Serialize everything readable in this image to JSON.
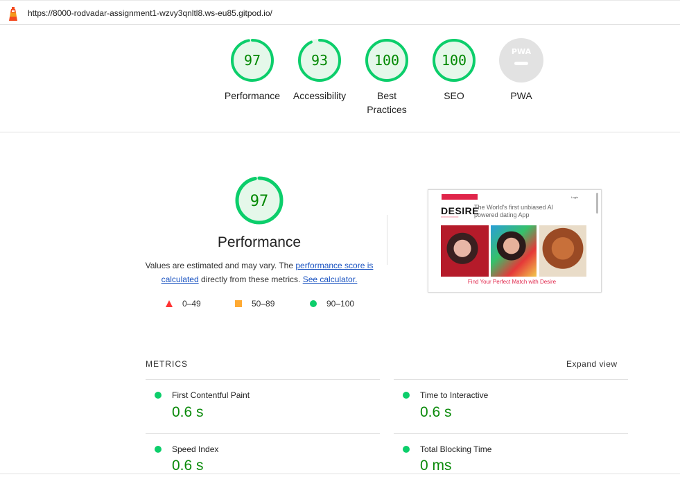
{
  "topbar": {
    "url": "https://8000-rodvadar-assignment1-wzvy3qnltl8.ws-eu85.gitpod.io/"
  },
  "gauges": [
    {
      "label": "Performance",
      "score": "97",
      "value": 97
    },
    {
      "label": "Accessibility",
      "score": "93",
      "value": 93
    },
    {
      "label": "Best\nPractices",
      "score": "100",
      "value": 100
    },
    {
      "label": "SEO",
      "score": "100",
      "value": 100
    },
    {
      "label": "PWA",
      "score": "",
      "value": null
    }
  ],
  "pwa_badge": "PWA",
  "performance": {
    "score": "97",
    "value": 97,
    "title": "Performance",
    "desc_prefix": "Values are estimated and may vary. The ",
    "link_score": "performance score is calculated",
    "desc_middle": " directly from these metrics. ",
    "link_calc": "See calculator."
  },
  "legend": [
    {
      "shape": "triangle",
      "range": "0–49",
      "color": "#ff3333"
    },
    {
      "shape": "square",
      "range": "50–89",
      "color": "#ffaa33"
    },
    {
      "shape": "circle",
      "range": "90–100",
      "color": "#0cce6b"
    }
  ],
  "screenshot": {
    "login": "Login",
    "brand": "DESIRE",
    "tagline": "The World's first unbiased AI powered dating App",
    "find": "Find Your Perfect Match with Desire"
  },
  "metrics": {
    "heading": "METRICS",
    "expand": "Expand view",
    "items": [
      {
        "name": "First Contentful Paint",
        "value": "0.6 s"
      },
      {
        "name": "Time to Interactive",
        "value": "0.6 s"
      },
      {
        "name": "Speed Index",
        "value": "0.6 s"
      },
      {
        "name": "Total Blocking Time",
        "value": "0 ms"
      }
    ]
  },
  "colors": {
    "pass": "#0cce6b",
    "pass_text": "#008800",
    "pass_fill": "#e5f8ea",
    "link": "#1a53c1",
    "fail": "#ff3333",
    "average": "#ffaa33"
  }
}
